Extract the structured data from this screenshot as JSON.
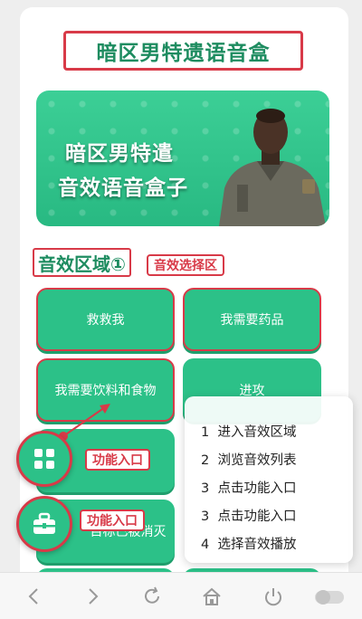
{
  "page": {
    "title": "暗区男特遗语音盒"
  },
  "banner": {
    "line1": "暗区男特遣",
    "line2": "音效语音盒子"
  },
  "section": {
    "label": "音效区域①",
    "tag": "音效选择区"
  },
  "sound_buttons": [
    {
      "label": "救救我"
    },
    {
      "label": "我需要药品"
    },
    {
      "label": "我需要饮料和食物"
    },
    {
      "label": "进攻"
    },
    {
      "label": "目标已被消灭"
    }
  ],
  "steps": [
    {
      "num": "1",
      "text": "进入音效区域"
    },
    {
      "num": "2",
      "text": "浏览音效列表"
    },
    {
      "num": "3",
      "text": "点击功能入口"
    },
    {
      "num": "3",
      "text": "点击功能入口"
    },
    {
      "num": "4",
      "text": "选择音效播放"
    }
  ],
  "fabs": {
    "grid_tip": "功能入口",
    "toolbox_tip": "功能入口"
  },
  "colors": {
    "accent_green": "#2cc188",
    "annotation_red": "#d83a48",
    "title_green": "#1e8c60"
  },
  "browser_nav": {
    "icons": [
      "back-icon",
      "forward-icon",
      "refresh-icon",
      "home-icon",
      "power-icon",
      "toggle-icon"
    ]
  }
}
